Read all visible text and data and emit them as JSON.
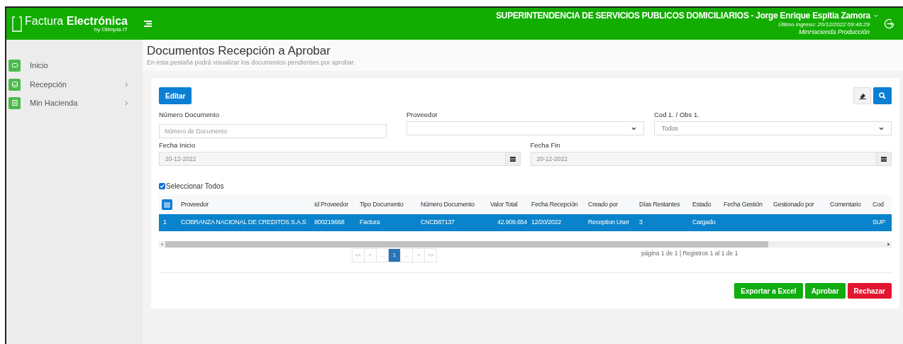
{
  "header": {
    "brand_light": "Factura",
    "brand_bold": "Electrónica",
    "brand_sub": "by Olimpia IT",
    "user": "SUPERINTENDENCIA DE SERVICIOS PUBLICOS DOMICILIARIOS - Jorge Enrique Espitia Zamora",
    "last_login": "Último ingreso: 20/12/2022 09:46:29",
    "environment": "MinHacienda Producción"
  },
  "sidebar": {
    "items": [
      {
        "label": "Inicio",
        "kind": "link"
      },
      {
        "label": "Recepción",
        "kind": "submenu"
      },
      {
        "label": "Min Hacienda",
        "kind": "submenu"
      }
    ]
  },
  "page": {
    "title": "Documentos Recepción a Aprobar",
    "subtitle": "En esta pestaña podrá visualizar los documentos pendientes por aprobar."
  },
  "toolbar": {
    "edit_button": "Editar"
  },
  "filters": [
    {
      "label": "Número Documento",
      "kind": "text",
      "placeholder": "Número de Documento"
    },
    {
      "label": "Proveedor",
      "kind": "select"
    },
    {
      "label": "Cod 1. / Obs 1.",
      "kind": "select",
      "value": "Todos"
    },
    {
      "label": "Fecha Inicio",
      "kind": "date",
      "value": "20-12-2022"
    },
    {
      "label": "Fecha Fin",
      "kind": "date",
      "value": "20-12-2022"
    }
  ],
  "select_all": {
    "label": "Seleccionar Todos",
    "checked": true
  },
  "table": {
    "columns": [
      "",
      "Proveedor",
      "Id Proveedor",
      "Tipo Documento",
      "Número Documento",
      "Valor Total",
      "Fecha Recepción",
      "Creado por",
      "Días Restantes",
      "Estado",
      "Fecha Gestión",
      "Gestionado por",
      "Comentario",
      "Cod"
    ],
    "rows": [
      {
        "selected": true,
        "cells": [
          "1",
          "COBRANZA NACIONAL DE CREDITOS S.A.S",
          "800219668",
          "Factura",
          "CNCB87137",
          "42.909.654",
          "12/20/2022",
          "Reception User",
          "3",
          "Cargado",
          "",
          "",
          "",
          "SUP"
        ]
      }
    ]
  },
  "pagination": {
    "pages": [
      {
        "label": "<<",
        "selected": false
      },
      {
        "label": "<",
        "selected": false
      },
      {
        "label": "...",
        "selected": false
      },
      {
        "label": "1",
        "selected": true
      },
      {
        "label": "...",
        "selected": false
      },
      {
        "label": ">",
        "selected": false
      },
      {
        "label": ">>",
        "selected": false
      }
    ],
    "summary": "página 1 de 1 | Registros 1 al 1 de 1"
  },
  "actions": [
    {
      "label": "Exportar a Excel",
      "kind": "success"
    },
    {
      "label": "Aprobar",
      "kind": "success"
    },
    {
      "label": "Rechazar",
      "kind": "danger"
    }
  ]
}
